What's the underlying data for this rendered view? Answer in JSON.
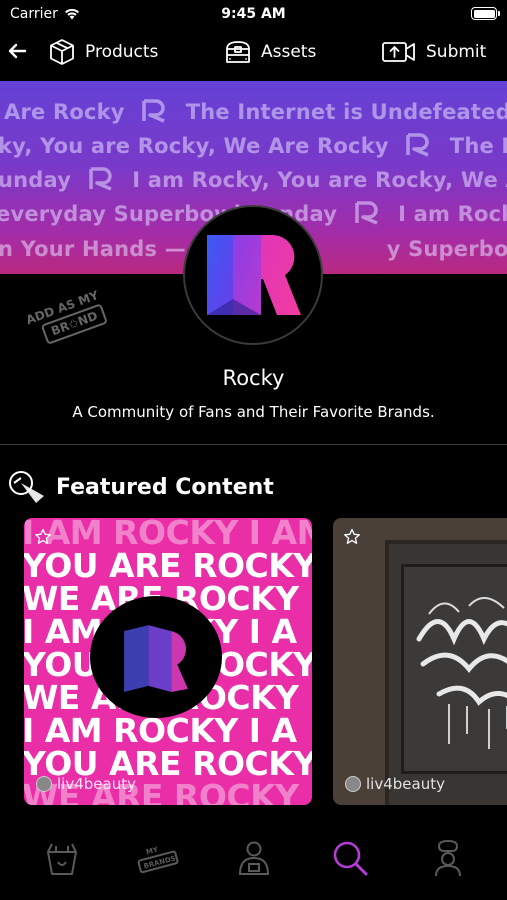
{
  "status": {
    "carrier": "Carrier",
    "time": "9:45 AM"
  },
  "nav": {
    "products_label": "Products",
    "assets_label": "Assets",
    "submit_label": "Submit"
  },
  "banner": {
    "rows": [
      "Are Rocky",
      "The Internet is Undefeated —— Rocky",
      "ky, You are Rocky, We Are Rocky",
      "The Internet",
      "unday",
      "I am Rocky, You are Rocky, We Are Rocky",
      "everyday Superbowl Sunday",
      "I am Rocky, You are",
      "n Your Hands — Mo",
      "y Superbowl Sunday"
    ]
  },
  "stamp": {
    "line1": "ADD AS MY",
    "line2": "BR✩ND"
  },
  "profile": {
    "name": "Rocky",
    "tagline": "A Community of Fans and Their Favorite Brands."
  },
  "featured": {
    "title": "Featured Content",
    "card1": {
      "author": "liv4beauty",
      "lines": [
        "I AM ROCKY I AM",
        "YOU ARE ROCKY",
        "WE ARE ROCKY",
        "I AM ROCKY I A",
        "YOU ARE ROCKY",
        "WE ARE ROCKY",
        "I AM ROCKY I A",
        "YOU ARE ROCKY",
        "WE ARE ROCKY"
      ]
    },
    "card2": {
      "author": "liv4beauty"
    }
  },
  "tabbar": {
    "tabs": [
      "products-tab",
      "my-brands-tab",
      "profile-tab",
      "search-tab",
      "chef-tab"
    ],
    "active_color": "#b53bd6"
  },
  "colors": {
    "banner_top": "#6441d6",
    "banner_bottom": "#b8297e",
    "card_pink": "#e92ea8",
    "accent": "#b53bd6"
  }
}
